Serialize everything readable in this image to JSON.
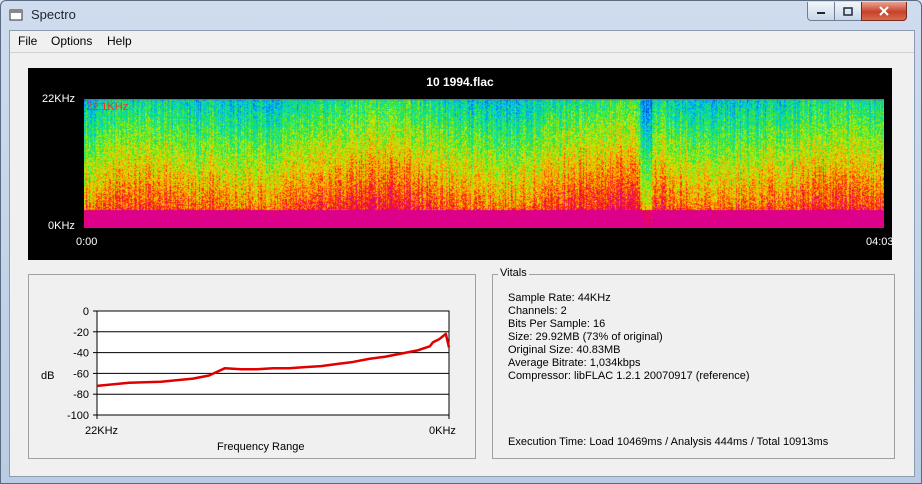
{
  "window": {
    "title": "Spectro"
  },
  "menu": [
    "File",
    "Options",
    "Help"
  ],
  "spectrogram": {
    "title": "10 1994.flac",
    "y_top": "22KHz",
    "y_bottom": "0KHz",
    "x_start": "0:00",
    "x_end": "04:03",
    "cutoff_label": "22.1KHz"
  },
  "graph": {
    "ylabel": "dB",
    "xlabel": "Frequency Range",
    "x_left": "22KHz",
    "x_right": "0KHz",
    "ticks": [
      "0",
      "-20",
      "-40",
      "-60",
      "-80",
      "-100"
    ],
    "line_color": "#e00000"
  },
  "chart_data": {
    "type": "line",
    "title": "",
    "xlabel": "Frequency Range",
    "ylabel": "dB",
    "ylim": [
      -100,
      0
    ],
    "x": [
      22,
      20,
      18,
      16,
      15,
      14,
      13,
      12,
      11,
      10,
      9,
      8,
      7,
      6,
      5,
      4,
      3,
      2,
      1.2,
      1,
      0.6,
      0.2,
      0
    ],
    "series": [
      {
        "values": [
          -72,
          -69,
          -68,
          -65,
          -62,
          -55,
          -56,
          -56,
          -55,
          -55,
          -54,
          -53,
          -51,
          -49,
          -46,
          -44,
          -41,
          -38,
          -34,
          -30,
          -27,
          -22,
          -35
        ]
      }
    ]
  },
  "vitals": {
    "legend": "Vitals",
    "lines": [
      "Sample Rate: 44KHz",
      "Channels: 2",
      "Bits Per Sample: 16",
      "Size: 29.92MB (73% of original)",
      "Original Size: 40.83MB",
      "Average Bitrate: 1,034kbps",
      "Compressor: libFLAC 1.2.1 20070917 (reference)"
    ],
    "execution": "Execution Time: Load 10469ms / Analysis 444ms / Total 10913ms"
  }
}
